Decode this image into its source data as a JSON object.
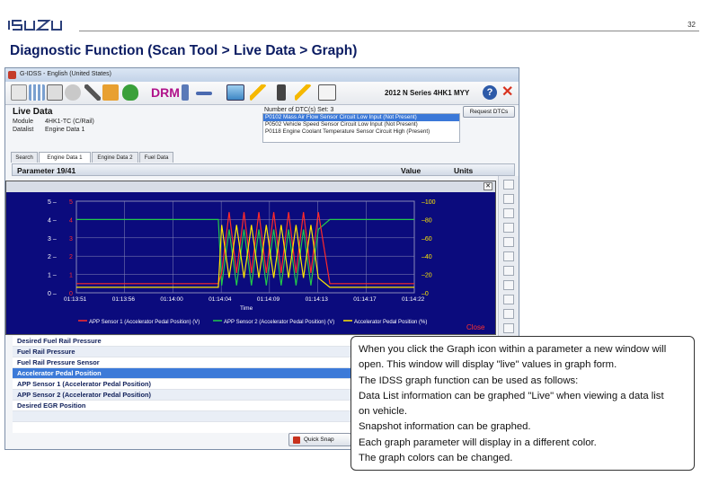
{
  "slide": {
    "brand": "ISUZU",
    "page_number": "32",
    "title": "Diagnostic Function (Scan Tool > Live Data > Graph)"
  },
  "app": {
    "window_title": "G-IDSS - English (United States)",
    "drm_label": "DRM",
    "vehicle": "2012 N Series 4HK1 MYY",
    "help_label": "?",
    "close_glyph": "✕"
  },
  "live_data": {
    "title": "Live Data",
    "module_label": "Module",
    "module_value": "4HK1-TC (C/Rail)",
    "datalist_label": "Datalist",
    "datalist_value": "Engine Data 1",
    "dtc_count_label": "Number of DTC(s) Set: 3",
    "request_dtcs": "Request DTCs",
    "dtcs": [
      "P0102 Mass Air Flow Sensor Circuit Low Input (Not Present)",
      "P0502 Vehicle Speed Sensor Circuit Low Input (Not Present)",
      "P0118 Engine Coolant Temperature Sensor Circuit High (Present)"
    ]
  },
  "tabs": [
    "Search",
    "Engine Data 1",
    "Engine Data 2",
    "Fuel Data"
  ],
  "table": {
    "param_header": "Parameter 19/41",
    "value_header": "Value",
    "units_header": "Units"
  },
  "graph": {
    "close_label": "Close",
    "x_axis_title": "Time",
    "x_ticks": [
      "01:13:51",
      "01:13:56",
      "01:14:00",
      "01:14:04",
      "01:14:09",
      "01:14:13",
      "01:14:17",
      "01:14:22"
    ],
    "y_left_white": [
      "5",
      "4",
      "3",
      "2",
      "1",
      "0"
    ],
    "y_left_red": [
      "5",
      "4",
      "3",
      "2",
      "1",
      "0"
    ],
    "y_right": [
      "100",
      "80",
      "60",
      "40",
      "20",
      "0"
    ],
    "legend": [
      "APP Sensor 1 (Accelerator Pedal Position) (V)",
      "APP Sensor 2 (Accelerator Pedal Position) (V)",
      "Accelerator Pedal Position (%)"
    ],
    "colors": {
      "bg": "#0b0b7d",
      "red": "#ff2a2a",
      "yellow": "#ffe800",
      "green": "#22c94a",
      "grid": "#8a8ab8"
    }
  },
  "parameters": [
    "Desired Fuel Rail Pressure",
    "Fuel Rail Pressure",
    "Fuel Rail Pressure Sensor",
    "Accelerator Pedal Position",
    "APP Sensor 1 (Accelerator Pedal Position)",
    "APP Sensor 2 (Accelerator Pedal Position)",
    "Desired EGR Position"
  ],
  "quick_snap": "Quick Snap",
  "callout_lines": [
    "When you click the Graph icon within a parameter a new window will",
    "open.  This window will display \"live\" values in graph form.",
    "The IDSS graph function can be used as follows:",
    "Data List information can be graphed \"Live\" when viewing a data list",
    "on vehicle.",
    "Snapshot information can be graphed.",
    "Each graph parameter will display in a different color.",
    "The graph colors can be changed."
  ]
}
